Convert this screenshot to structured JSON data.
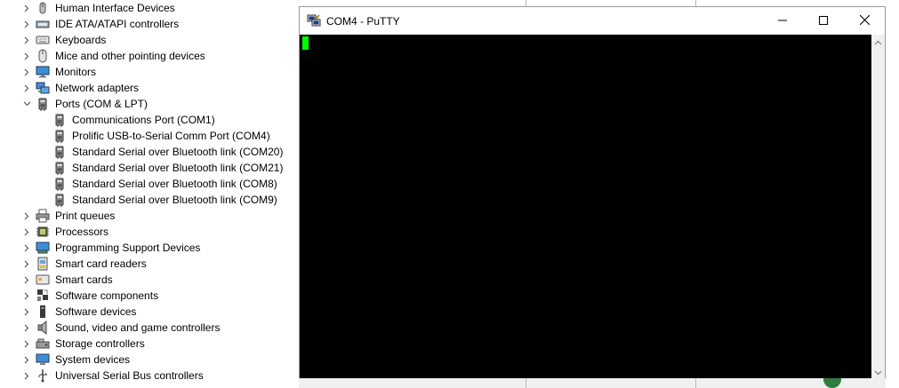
{
  "tree": {
    "items": [
      {
        "label": "Human Interface Devices",
        "icon": "hid-icon",
        "expanded": false,
        "child": false
      },
      {
        "label": "IDE ATA/ATAPI controllers",
        "icon": "ide-controller-icon",
        "expanded": false,
        "child": false
      },
      {
        "label": "Keyboards",
        "icon": "keyboard-icon",
        "expanded": false,
        "child": false
      },
      {
        "label": "Mice and other pointing devices",
        "icon": "mouse-icon",
        "expanded": false,
        "child": false
      },
      {
        "label": "Monitors",
        "icon": "monitor-icon",
        "expanded": false,
        "child": false
      },
      {
        "label": "Network adapters",
        "icon": "network-adapter-icon",
        "expanded": false,
        "child": false
      },
      {
        "label": "Ports (COM & LPT)",
        "icon": "port-icon",
        "expanded": true,
        "child": false
      },
      {
        "label": "Communications Port (COM1)",
        "icon": "port-icon",
        "child": true
      },
      {
        "label": "Prolific USB-to-Serial Comm Port (COM4)",
        "icon": "port-icon",
        "child": true
      },
      {
        "label": "Standard Serial over Bluetooth link (COM20)",
        "icon": "port-icon",
        "child": true
      },
      {
        "label": "Standard Serial over Bluetooth link (COM21)",
        "icon": "port-icon",
        "child": true
      },
      {
        "label": "Standard Serial over Bluetooth link (COM8)",
        "icon": "port-icon",
        "child": true
      },
      {
        "label": "Standard Serial over Bluetooth link (COM9)",
        "icon": "port-icon",
        "child": true
      },
      {
        "label": "Print queues",
        "icon": "printer-icon",
        "expanded": false,
        "child": false
      },
      {
        "label": "Processors",
        "icon": "processor-icon",
        "expanded": false,
        "child": false
      },
      {
        "label": "Programming Support Devices",
        "icon": "programming-device-icon",
        "expanded": false,
        "child": false
      },
      {
        "label": "Smart card readers",
        "icon": "smart-card-reader-icon",
        "expanded": false,
        "child": false
      },
      {
        "label": "Smart cards",
        "icon": "smart-card-icon",
        "expanded": false,
        "child": false
      },
      {
        "label": "Software components",
        "icon": "software-component-icon",
        "expanded": false,
        "child": false
      },
      {
        "label": "Software devices",
        "icon": "software-device-icon",
        "expanded": false,
        "child": false
      },
      {
        "label": "Sound, video and game controllers",
        "icon": "speaker-icon",
        "expanded": false,
        "child": false
      },
      {
        "label": "Storage controllers",
        "icon": "storage-controller-icon",
        "expanded": false,
        "child": false
      },
      {
        "label": "System devices",
        "icon": "system-device-icon",
        "expanded": false,
        "child": false
      },
      {
        "label": "Universal Serial Bus controllers",
        "icon": "usb-icon",
        "expanded": false,
        "child": false
      }
    ]
  },
  "putty": {
    "title": "COM4 - PuTTY",
    "cursor_color": "#00ff00",
    "terminal_bg": "#000000"
  }
}
